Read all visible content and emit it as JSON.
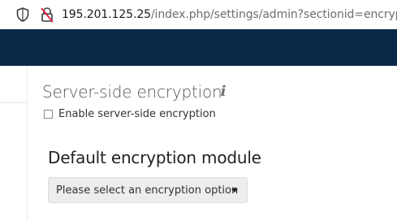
{
  "browser": {
    "url_host": "195.201.125.25",
    "url_path": "/index.php/settings/admin?sectionid=encryption"
  },
  "section": {
    "title": "Server-side encryption",
    "info_glyph": "i",
    "enable_label": "Enable server-side encryption",
    "enable_checked": false
  },
  "module": {
    "title": "Default encryption module",
    "select_label": "Please select an encryption option"
  },
  "colors": {
    "header_bg": "#0a2747",
    "select_bg": "#ededed"
  },
  "icons": {
    "shield": "shield-icon",
    "lock": "lock-insecure-icon",
    "info": "info-icon",
    "caret": "caret-down-icon"
  }
}
